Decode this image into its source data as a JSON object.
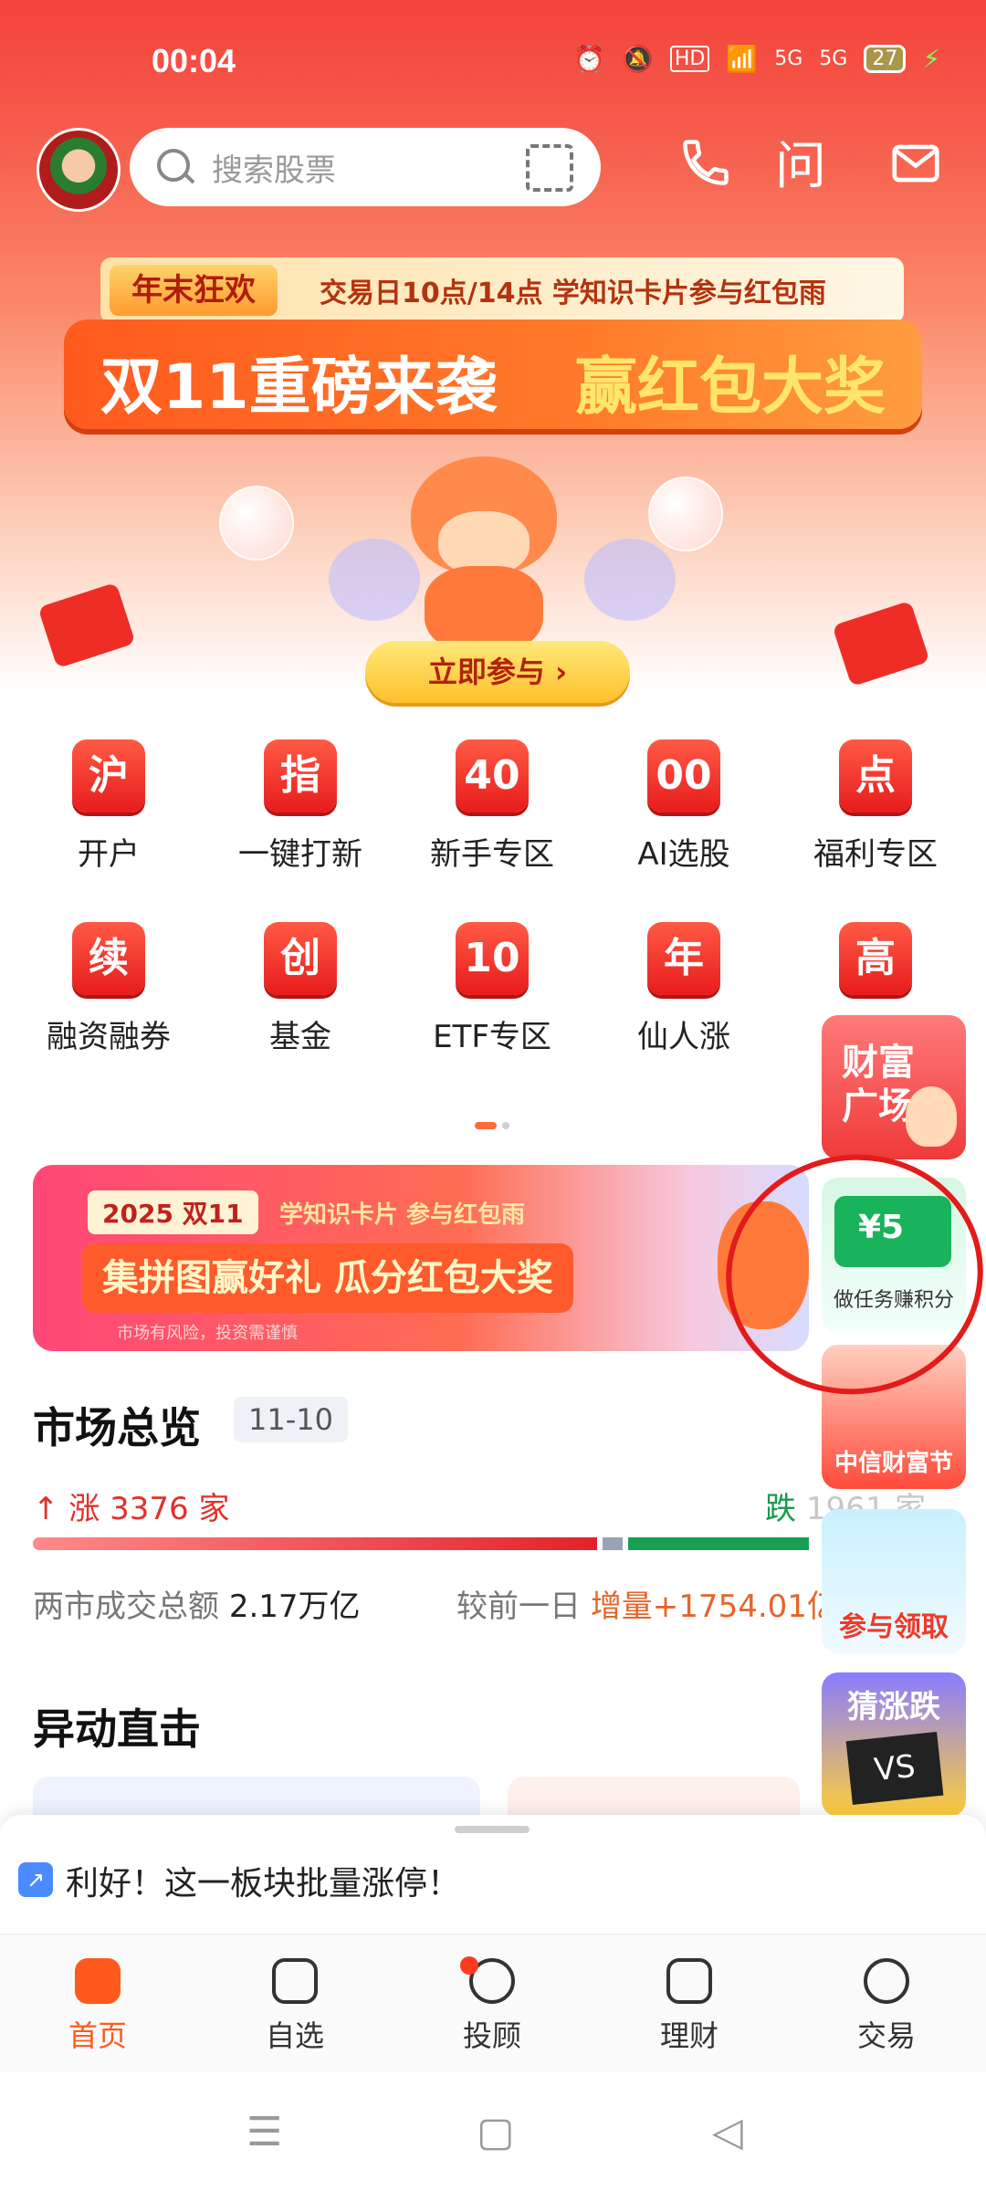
{
  "status": {
    "time": "00:04",
    "battery": "27",
    "signal1": "5G",
    "signal2": "5G",
    "hd": "HD"
  },
  "header": {
    "search_placeholder": "搜索股票",
    "phone_icon": "phone-icon",
    "ask": "问",
    "mail_icon": "mail-icon"
  },
  "banner": {
    "tag": "年末狂欢",
    "tag_text": "交易日10点/14点 学知识卡片参与红包雨",
    "headline_1": "双11重磅来袭",
    "headline_2": "赢红包大奖",
    "button": "立即参与"
  },
  "menu": {
    "row1": [
      {
        "icon": "沪",
        "label": "开户"
      },
      {
        "icon": "指",
        "label": "一键打新"
      },
      {
        "icon": "40",
        "label": "新手专区"
      },
      {
        "icon": "00",
        "label": "AI选股"
      },
      {
        "icon": "点",
        "label": "福利专区"
      }
    ],
    "row2": [
      {
        "icon": "续",
        "label": "融资融券"
      },
      {
        "icon": "创",
        "label": "基金"
      },
      {
        "icon": "10",
        "label": "ETF专区"
      },
      {
        "icon": "年",
        "label": "仙人涨"
      },
      {
        "icon": "高",
        "label": ""
      }
    ]
  },
  "float": {
    "fortune": "财富广场",
    "task_value": "¥5",
    "task_label": "做任务赚积分",
    "citic": "中信财富节",
    "claim": "参与领取",
    "guess_title": "猜涨跌",
    "guess_vs": "VS"
  },
  "promo": {
    "year": "2025 双11",
    "small": "学知识卡片 参与红包雨",
    "big": "集拼图赢好礼 瓜分红包大奖",
    "risk": "市场有风险，投资需谨慎"
  },
  "market": {
    "title": "市场总览",
    "date": "11-10",
    "rise": "涨 3376 家",
    "fall": "跌",
    "fall_count": "1961 家",
    "turnover_label": "两市成交总额",
    "turnover_value": "2.17万亿",
    "compare_label": "较前一日",
    "compare_value": "增量+1754.01亿"
  },
  "movers": {
    "title": "异动直击"
  },
  "news": {
    "text": "利好！这一板块批量涨停！"
  },
  "nav": [
    {
      "label": "首页",
      "active": true
    },
    {
      "label": "自选",
      "active": false
    },
    {
      "label": "投顾",
      "active": false
    },
    {
      "label": "理财",
      "active": false
    },
    {
      "label": "交易",
      "active": false
    }
  ],
  "colors": {
    "brand": "#ff5a1e",
    "up": "#e3302a",
    "down": "#1a9b4e"
  }
}
